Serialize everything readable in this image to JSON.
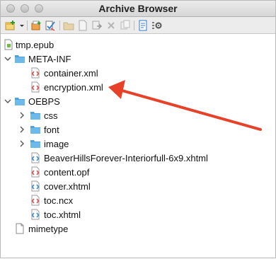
{
  "window": {
    "title": "Archive Browser"
  },
  "toolbar": {
    "buttons": [
      "add-archive-icon",
      "dropdown-arrow-icon",
      "add-folder-icon",
      "validate-icon",
      "new-folder-icon",
      "new-file-icon",
      "extract-icon",
      "delete-icon",
      "copy-icon",
      "preview-icon",
      "settings-icon"
    ]
  },
  "tree": {
    "root": "tmp.epub",
    "meta_inf": {
      "label": "META-INF",
      "children": [
        "container.xml",
        "encryption.xml"
      ]
    },
    "oebps": {
      "label": "OEBPS",
      "folders": [
        "css",
        "font",
        "image"
      ],
      "files": [
        "BeaverHillsForever-Interiorfull-6x9.xhtml",
        "content.opf",
        "cover.xhtml",
        "toc.ncx",
        "toc.xhtml"
      ]
    },
    "mimetype": "mimetype"
  },
  "colors": {
    "folder": "#4aa3df",
    "xml_icon": "#d9534f",
    "xhtml_icon": "#3a8fd0",
    "arrow": "#e8412a"
  }
}
